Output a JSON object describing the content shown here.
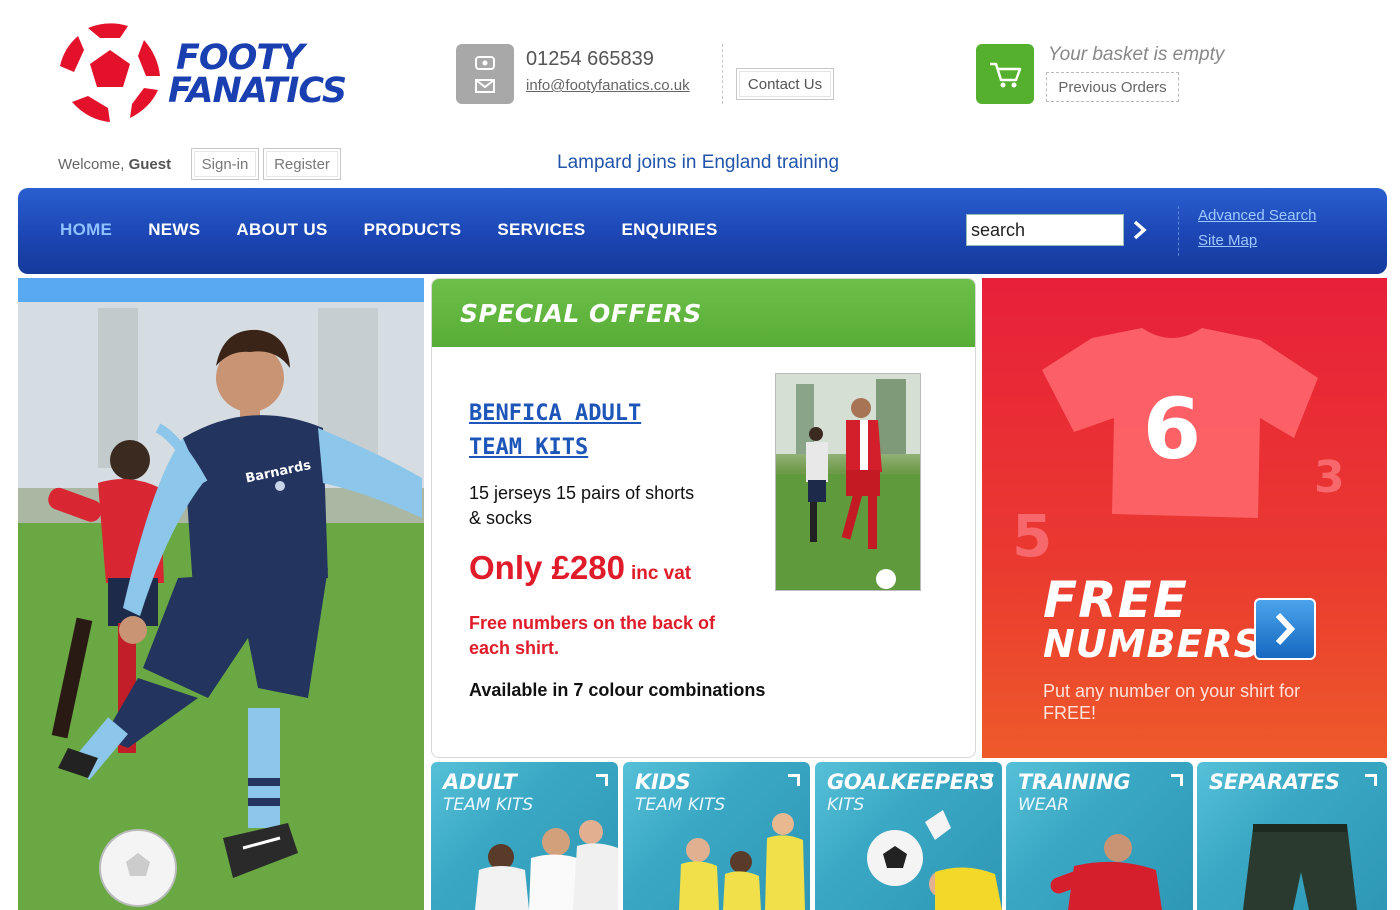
{
  "brand": {
    "line1": "FOOTY",
    "line2": "FANATICS"
  },
  "contact": {
    "phone": "01254 665839",
    "email": "info@footyfanatics.co.uk",
    "contact_us": "Contact Us"
  },
  "basket": {
    "status": "Your basket is empty",
    "previous_orders": "Previous Orders"
  },
  "user": {
    "welcome": "Welcome,",
    "name": "Guest",
    "signin": "Sign-in",
    "register": "Register"
  },
  "ticker": "Lampard joins in England training",
  "nav": {
    "items": [
      {
        "label": "HOME",
        "active": true
      },
      {
        "label": "NEWS"
      },
      {
        "label": "ABOUT US"
      },
      {
        "label": "PRODUCTS"
      },
      {
        "label": "SERVICES"
      },
      {
        "label": "ENQUIRIES"
      }
    ],
    "search_value": "search",
    "advanced_search": "Advanced Search",
    "site_map": "Site Map"
  },
  "offer": {
    "heading": "SPECIAL OFFERS",
    "link_line1": "BENFICA ADULT",
    "link_line2": "TEAM KITS",
    "desc": "15 jerseys 15 pairs of shorts & socks",
    "price": "Only £280",
    "price_suffix": "inc vat",
    "note": "Free numbers on the back of each shirt.",
    "availability": "Available in 7 colour combinations"
  },
  "promo": {
    "line1": "FREE",
    "line2": "NUMBERS",
    "sub": "Put any number on your shirt for FREE!",
    "shirt_number": "6",
    "num_left": "5",
    "num_right": "3"
  },
  "tiles": [
    {
      "title": "ADULT",
      "sub": "TEAM KITS"
    },
    {
      "title": "KIDS",
      "sub": "TEAM KITS"
    },
    {
      "title": "GOALKEEPERS",
      "sub": "KITS"
    },
    {
      "title": "TRAINING",
      "sub": "WEAR"
    },
    {
      "title": "SEPARATES",
      "sub": ""
    }
  ],
  "hero": {
    "shirt_text": "Barnards"
  },
  "colors": {
    "nav_blue": "#1c46b4",
    "green": "#58ad36",
    "red": "#e01c2a",
    "tile": "#3aa8c4"
  }
}
